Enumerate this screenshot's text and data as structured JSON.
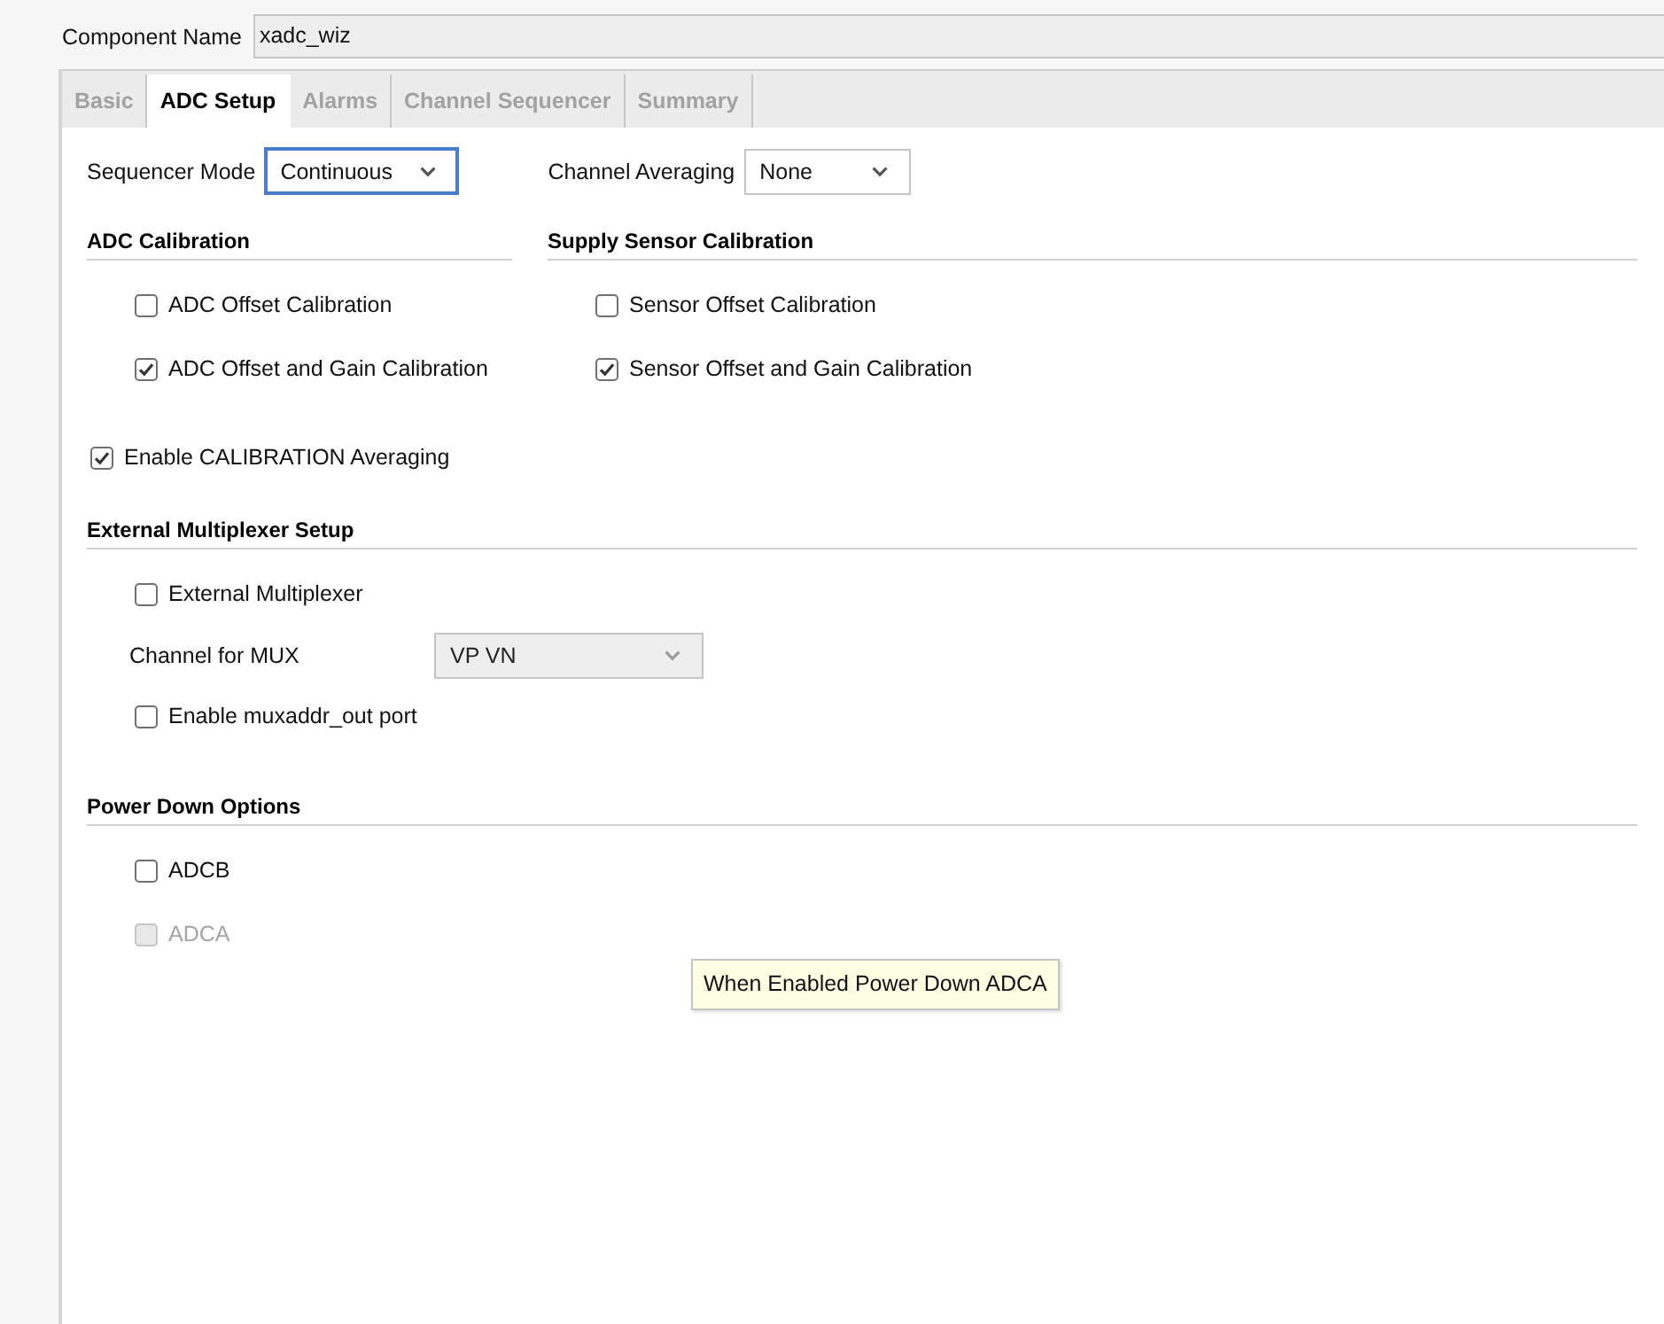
{
  "component_name": {
    "label": "Component Name",
    "value": "xadc_wiz"
  },
  "tabs": [
    {
      "label": "Basic",
      "selected": false
    },
    {
      "label": "ADC Setup",
      "selected": true
    },
    {
      "label": "Alarms",
      "selected": false
    },
    {
      "label": "Channel Sequencer",
      "selected": false
    },
    {
      "label": "Summary",
      "selected": false
    }
  ],
  "mode_row": [
    {
      "label": "Sequencer Mode",
      "value": "Continuous",
      "focused": true
    },
    {
      "label": "Channel Averaging",
      "value": "None",
      "focused": false
    }
  ],
  "calibration_groups": [
    {
      "title": "ADC Calibration",
      "options": [
        {
          "label": "ADC Offset Calibration",
          "checked": false
        },
        {
          "label": "ADC Offset and Gain Calibration",
          "checked": true
        }
      ]
    },
    {
      "title": "Supply Sensor Calibration",
      "options": [
        {
          "label": "Sensor Offset Calibration",
          "checked": false
        },
        {
          "label": "Sensor Offset and Gain Calibration",
          "checked": true
        }
      ]
    }
  ],
  "calibration_averaging": {
    "label": "Enable CALIBRATION Averaging",
    "checked": true
  },
  "external_multiplexer": {
    "title": "External Multiplexer Setup",
    "external_mux": {
      "label": "External Multiplexer",
      "checked": false
    },
    "channel_for_mux": {
      "label": "Channel for MUX",
      "value": "VP VN",
      "disabled": true
    },
    "muxaddr_out": {
      "label": "Enable muxaddr_out port",
      "checked": false
    }
  },
  "power_down": {
    "title": "Power Down Options",
    "options": [
      {
        "label": "ADCB",
        "checked": false,
        "disabled": false
      },
      {
        "label": "ADCA",
        "checked": false,
        "disabled": true
      }
    ]
  },
  "tooltip": {
    "text": "When Enabled Power Down ADCA"
  }
}
